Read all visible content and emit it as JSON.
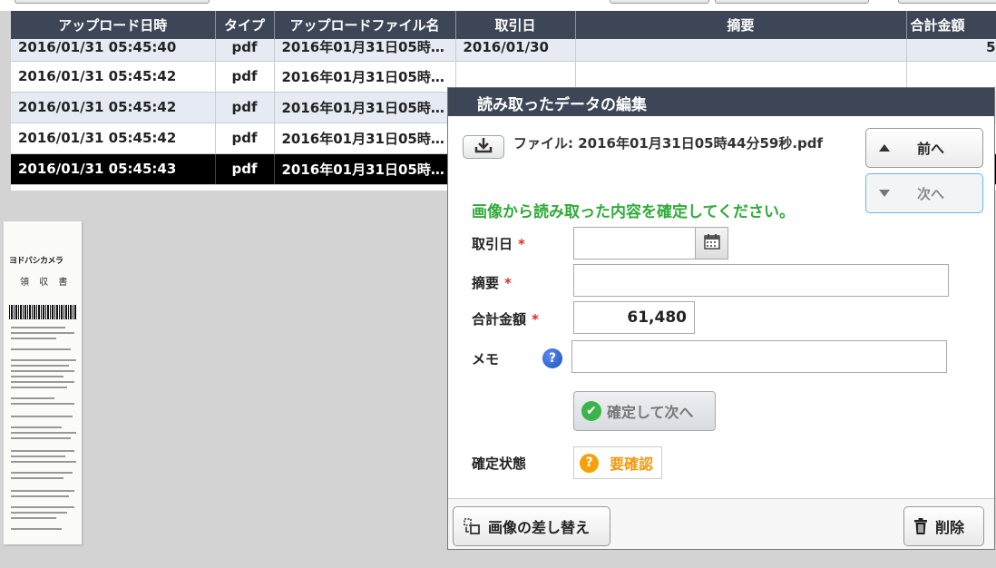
{
  "table": {
    "headers": [
      "アップロード日時",
      "タイプ",
      "アップロードファイル名",
      "取引日",
      "摘要",
      "合計金額"
    ],
    "rows": [
      {
        "datetime": "2016/01/31 05:45:40",
        "type": "pdf",
        "filename": "2016年01月31日05時…",
        "date": "2016/01/30",
        "memo": "",
        "amount": "5"
      },
      {
        "datetime": "2016/01/31 05:45:42",
        "type": "pdf",
        "filename": "2016年01月31日05時…",
        "date": "",
        "memo": "",
        "amount": ""
      },
      {
        "datetime": "2016/01/31 05:45:42",
        "type": "pdf",
        "filename": "2016年01月31日05時…",
        "date": "",
        "memo": "",
        "amount": ""
      },
      {
        "datetime": "2016/01/31 05:45:42",
        "type": "pdf",
        "filename": "2016年01月31日05時…",
        "date": "",
        "memo": "",
        "amount": ""
      },
      {
        "datetime": "2016/01/31 05:45:43",
        "type": "pdf",
        "filename": "2016年01月31日05時…",
        "date": "",
        "memo": "",
        "amount": ""
      }
    ]
  },
  "receipt": {
    "logo_text": "ヨドバシカメラ",
    "title_text": "領 収 書"
  },
  "modal": {
    "title": "読み取ったデータの編集",
    "file_label": "ファイル: 2016年01月31日05時44分59秒.pdf",
    "prev_label": "前へ",
    "next_label": "次へ",
    "instruction": "画像から読み取った内容を確定してください。",
    "date_label": "取引日",
    "date_value": "",
    "summary_label": "摘要",
    "summary_value": "",
    "total_label": "合計金額",
    "total_value": "61,480",
    "memo_label": "メモ",
    "memo_value": "",
    "required_mark": "*",
    "help_glyph": "?",
    "confirm_label": "確定して次へ",
    "status_label": "確定状態",
    "status_value": "要確認",
    "replace_label": "画像の差し替え",
    "delete_label": "削除"
  },
  "icons": {
    "download": "download-icon",
    "calendar": "calendar-icon",
    "help": "help-icon",
    "check": "check-icon",
    "question": "question-icon",
    "replace": "replace-image-icon",
    "trash": "trash-icon"
  },
  "colors": {
    "header_bg": "#3d4657",
    "instruction_green": "#2faa3a",
    "required_red": "#d93025",
    "status_orange": "#f29a0e",
    "selected_row": "#000000"
  }
}
